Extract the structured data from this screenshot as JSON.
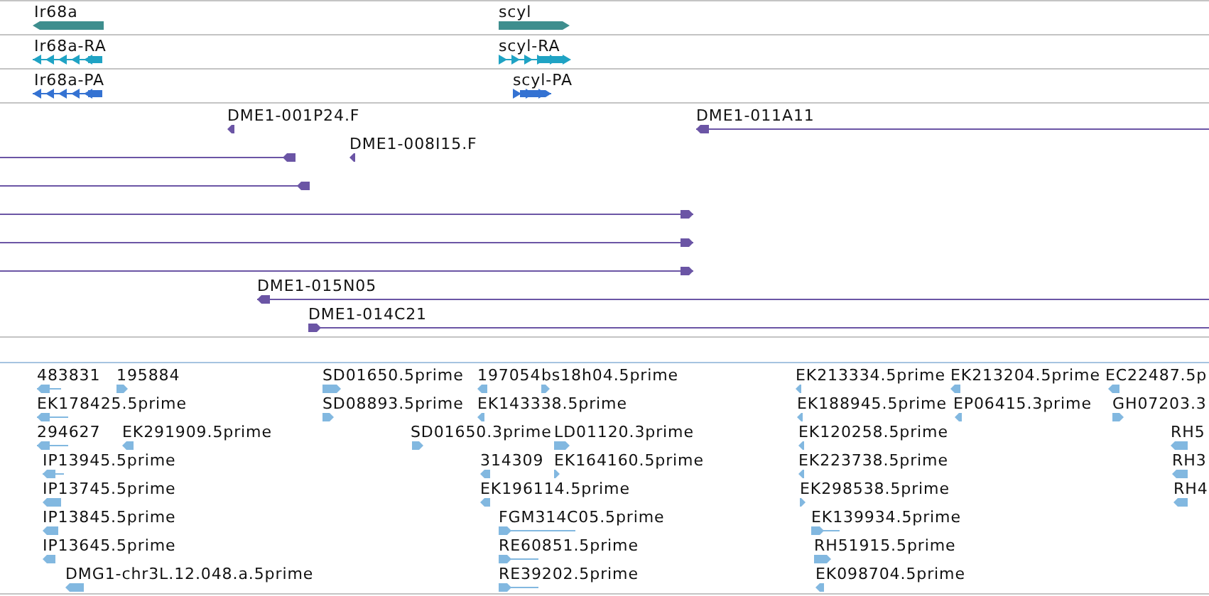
{
  "tracks": [
    {
      "kind": "gene",
      "color": "#3e8e8e",
      "features": [
        {
          "label": "Ir68a",
          "reverse": true
        },
        {
          "label": "scyl",
          "reverse": false
        }
      ]
    },
    {
      "kind": "transcript",
      "color": "#1fa3c4",
      "features": [
        {
          "label": "Ir68a-RA",
          "reverse": true
        },
        {
          "label": "scyl-RA",
          "reverse": false
        }
      ]
    },
    {
      "kind": "transcript",
      "color": "#3472d2",
      "features": [
        {
          "label": "Ir68a-PA",
          "reverse": true
        },
        {
          "label": "scyl-PA",
          "reverse": false
        }
      ]
    },
    {
      "kind": "clone",
      "color": "#6b55a5",
      "features": [
        {
          "label": "DME1-001P24.F",
          "reverse": true
        },
        {
          "label": "DME1-011A11",
          "reverse": true
        },
        {
          "label": "DME1-008I15.F",
          "reverse": true
        },
        {
          "reverse": true
        },
        {
          "reverse": true
        },
        {
          "reverse": false
        },
        {
          "reverse": false
        },
        {
          "reverse": false
        },
        {
          "label": "DME1-015N05",
          "reverse": true
        },
        {
          "label": "DME1-014C21",
          "reverse": false
        }
      ]
    },
    {
      "kind": "est",
      "color": "#82b8e0",
      "features": [
        {
          "label": "483831",
          "reverse": true
        },
        {
          "label": "195884",
          "reverse": false
        },
        {
          "label": "SD01650.5prime",
          "reverse": false
        },
        {
          "label": "197054",
          "reverse": true
        },
        {
          "label": "bs18h04.5prime",
          "reverse": false
        },
        {
          "label": "EK213334.5prime",
          "reverse": true
        },
        {
          "label": "EK213204.5prime",
          "reverse": true
        },
        {
          "label": "EC22487.5p",
          "reverse": true
        },
        {
          "label": "EK178425.5prime",
          "reverse": true
        },
        {
          "label": "SD08893.5prime",
          "reverse": false
        },
        {
          "label": "EK143338.5prime",
          "reverse": true
        },
        {
          "label": "EK188945.5prime",
          "reverse": true
        },
        {
          "label": "EP06415.3prime",
          "reverse": true
        },
        {
          "label": "GH07203.3",
          "reverse": false
        },
        {
          "label": "294627",
          "reverse": true
        },
        {
          "label": "EK291909.5prime",
          "reverse": true
        },
        {
          "label": "SD01650.3prime",
          "reverse": false
        },
        {
          "label": "LD01120.3prime",
          "reverse": false
        },
        {
          "label": "EK120258.5prime",
          "reverse": true
        },
        {
          "label": "RH5",
          "reverse": true
        },
        {
          "label": "IP13945.5prime",
          "reverse": true
        },
        {
          "label": "314309",
          "reverse": true
        },
        {
          "label": "EK164160.5prime",
          "reverse": false
        },
        {
          "label": "EK223738.5prime",
          "reverse": true
        },
        {
          "label": "RH3",
          "reverse": true
        },
        {
          "label": "IP13745.5prime",
          "reverse": true
        },
        {
          "label": "EK196114.5prime",
          "reverse": true
        },
        {
          "label": "EK298538.5prime",
          "reverse": false
        },
        {
          "label": "RH4",
          "reverse": true
        },
        {
          "label": "IP13845.5prime",
          "reverse": true
        },
        {
          "label": "FGM314C05.5prime",
          "reverse": false
        },
        {
          "label": "EK139934.5prime",
          "reverse": false
        },
        {
          "label": "IP13645.5prime",
          "reverse": true
        },
        {
          "label": "RE60851.5prime",
          "reverse": false
        },
        {
          "label": "RH51915.5prime",
          "reverse": false
        },
        {
          "label": "DMG1-chr3L.12.048.a.5prime",
          "reverse": true
        },
        {
          "label": "RE39202.5prime",
          "reverse": false
        },
        {
          "label": "EK098704.5prime",
          "reverse": true
        }
      ]
    }
  ]
}
